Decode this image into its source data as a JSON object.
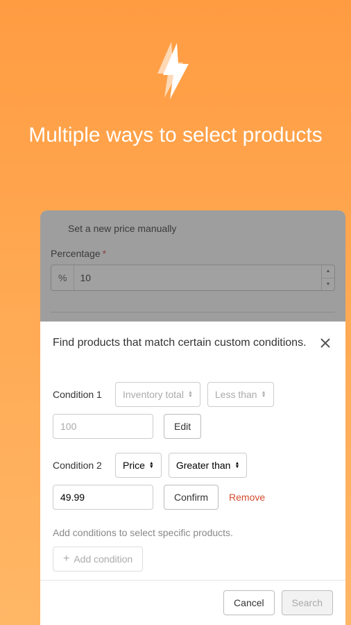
{
  "hero": {
    "title": "Multiple ways to select products"
  },
  "background": {
    "manual_price_label": "Set a new price manually",
    "percentage_label": "Percentage",
    "percentage_prefix": "%",
    "percentage_value": "10"
  },
  "modal": {
    "title": "Find products that match certain custom conditions.",
    "conditions": [
      {
        "label": "Condition 1",
        "field": "Inventory total",
        "operator": "Less than",
        "value": "100",
        "action": "Edit",
        "disabled": true
      },
      {
        "label": "Condition 2",
        "field": "Price",
        "operator": "Greater than",
        "value": "49.99",
        "action": "Confirm",
        "removable": true,
        "remove_label": "Remove",
        "disabled": false
      }
    ],
    "help_text": "Add conditions to select specific products.",
    "add_condition_label": "Add condition",
    "cancel_label": "Cancel",
    "search_label": "Search"
  }
}
